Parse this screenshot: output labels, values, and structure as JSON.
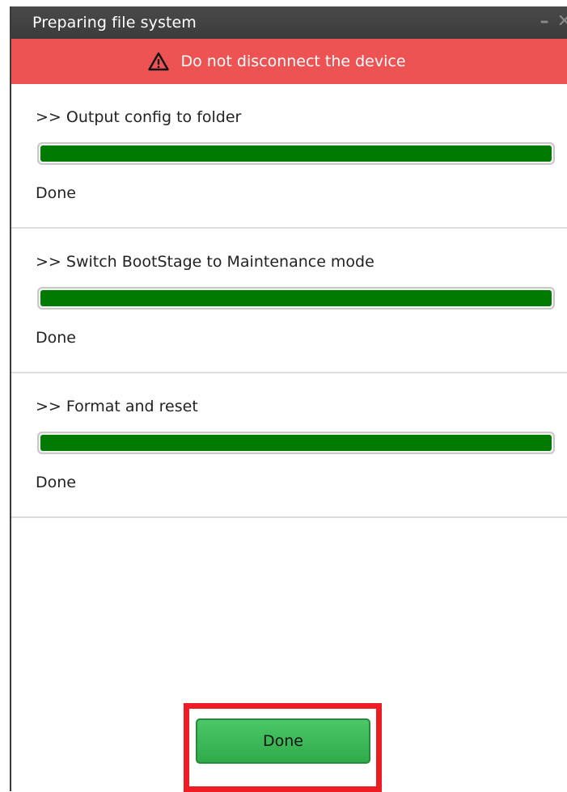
{
  "window": {
    "title": "Preparing file system",
    "controls": {
      "minimize": "–",
      "close": "✕"
    }
  },
  "warning": {
    "text": "Do not disconnect the device",
    "icon": "warning-triangle-icon",
    "color": "#ee5353"
  },
  "steps": [
    {
      "title": ">> Output config to folder",
      "progress": 1.0,
      "status": "Done"
    },
    {
      "title": ">> Switch BootStage to Maintenance mode",
      "progress": 1.0,
      "status": "Done"
    },
    {
      "title": ">> Format and reset",
      "progress": 1.0,
      "status": "Done"
    }
  ],
  "footer": {
    "done_label": "Done"
  },
  "colors": {
    "progress_fill": "#007a00",
    "button": "#3cba57",
    "highlight": "#ee1c25"
  }
}
